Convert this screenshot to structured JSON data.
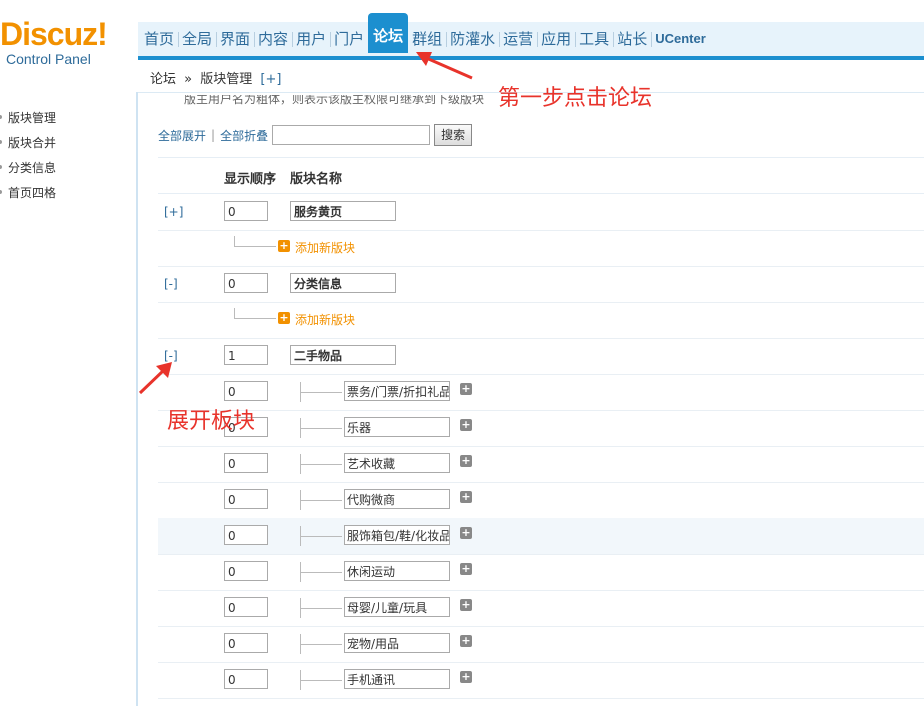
{
  "logo": {
    "brand": "Discuz!",
    "sub": "Control Panel"
  },
  "topnav": [
    {
      "label": "首页"
    },
    {
      "label": "全局"
    },
    {
      "label": "界面"
    },
    {
      "label": "内容"
    },
    {
      "label": "用户"
    },
    {
      "label": "门户"
    },
    {
      "label": "论坛",
      "active": true
    },
    {
      "label": "群组"
    },
    {
      "label": "防灌水"
    },
    {
      "label": "运营"
    },
    {
      "label": "应用"
    },
    {
      "label": "工具"
    },
    {
      "label": "站长"
    },
    {
      "label": "UCenter"
    }
  ],
  "breadcrumb": {
    "root": "论坛",
    "sep": "»",
    "current": "版块管理",
    "add": "[+]"
  },
  "sidebar": {
    "items": [
      {
        "label": "版块管理"
      },
      {
        "label": "版块合并"
      },
      {
        "label": "分类信息"
      },
      {
        "label": "首页四格"
      }
    ]
  },
  "tip": "版主用户名为粗体，则表示该版主权限可继承到下级版块",
  "toolbar": {
    "expand_all": "全部展开",
    "sep": "|",
    "collapse_all": "全部折叠",
    "search_value": "",
    "search_button": "搜索"
  },
  "columns": {
    "order": "显示顺序",
    "name": "版块名称"
  },
  "groups": [
    {
      "toggle": "[+]",
      "order": "0",
      "name": "服务黄页",
      "add_label": "添加新版块"
    },
    {
      "toggle": "[-]",
      "order": "0",
      "name": "分类信息",
      "add_label": "添加新版块"
    },
    {
      "toggle": "[-]",
      "order": "1",
      "name": "二手物品"
    }
  ],
  "subforums": [
    {
      "order": "0",
      "name": "票务/门票/折扣礼品"
    },
    {
      "order": "0",
      "name": "乐器"
    },
    {
      "order": "0",
      "name": "艺术收藏"
    },
    {
      "order": "0",
      "name": "代购微商"
    },
    {
      "order": "0",
      "name": "服饰箱包/鞋/化妆品",
      "highlight": true
    },
    {
      "order": "0",
      "name": "休闲运动"
    },
    {
      "order": "0",
      "name": "母婴/儿童/玩具"
    },
    {
      "order": "0",
      "name": "宠物/用品"
    },
    {
      "order": "0",
      "name": "手机通讯"
    }
  ],
  "annotations": {
    "step1": "第一步点击论坛",
    "expand": "展开板块"
  },
  "colors": {
    "accent": "#1c8fcf",
    "logo": "#f29100",
    "link": "#2e6b9a",
    "annotation": "#e8332b"
  }
}
